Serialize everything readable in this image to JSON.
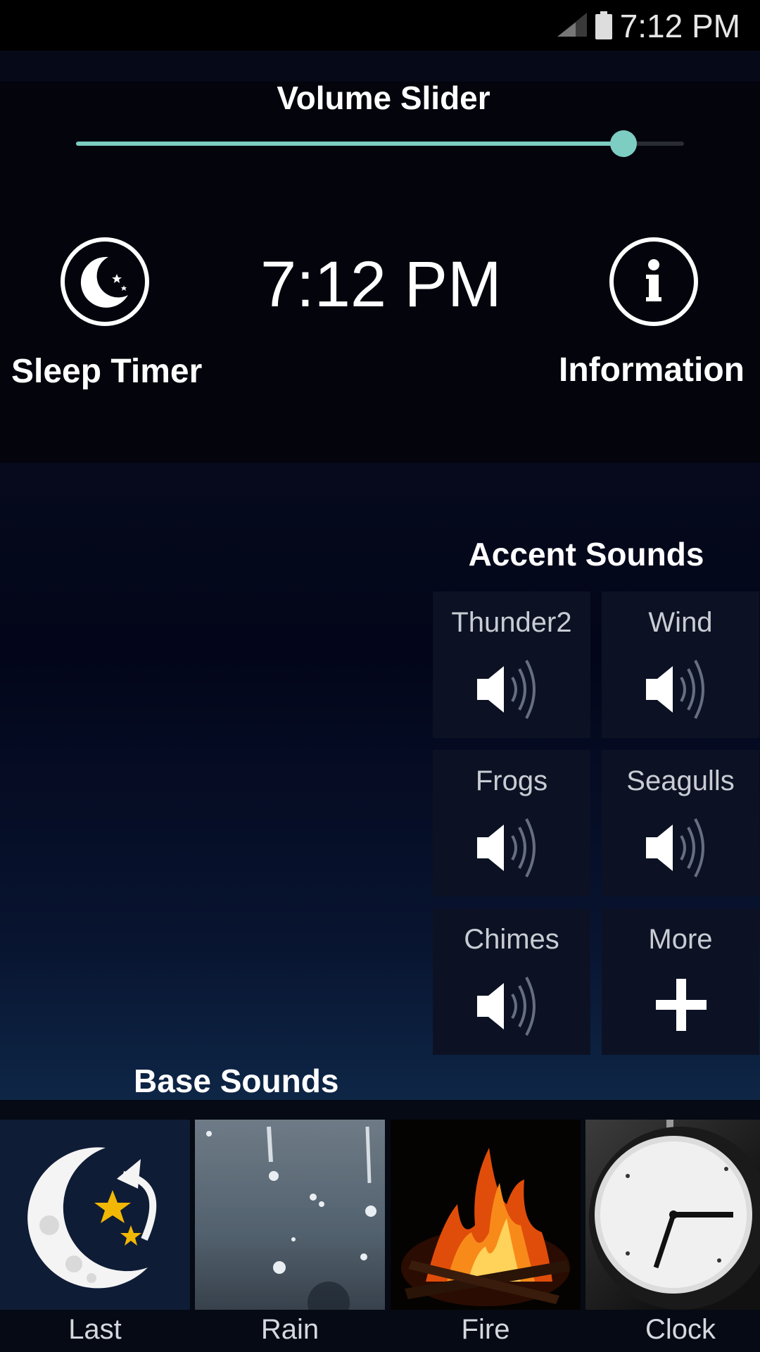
{
  "status_bar": {
    "time": "7:12 PM",
    "signal_icon": "signal-icon",
    "battery_icon": "battery-icon"
  },
  "volume": {
    "title": "Volume Slider",
    "level": 0.9
  },
  "controls": {
    "sleep_timer_label": "Sleep Timer",
    "information_label": "Information",
    "clock": "7:12 PM",
    "sleep_icon": "moon-stars-icon",
    "info_icon": "info-icon"
  },
  "accent": {
    "title": "Accent Sounds",
    "tiles": [
      {
        "label": "Thunder2",
        "icon": "speaker-icon"
      },
      {
        "label": "Wind",
        "icon": "speaker-icon"
      },
      {
        "label": "Frogs",
        "icon": "speaker-icon"
      },
      {
        "label": "Seagulls",
        "icon": "speaker-icon"
      },
      {
        "label": "Chimes",
        "icon": "speaker-icon"
      },
      {
        "label": "More",
        "icon": "plus-icon"
      }
    ]
  },
  "base": {
    "title": "Base Sounds",
    "items": [
      {
        "label": "Last",
        "icon": "moon-replay-icon"
      },
      {
        "label": "Rain",
        "icon": "rain-image"
      },
      {
        "label": "Fire",
        "icon": "fire-image"
      },
      {
        "label": "Clock",
        "icon": "clock-image"
      }
    ]
  },
  "colors": {
    "accent": "#7dcdc2",
    "panel": "#03040c",
    "tile": "#0c1224"
  }
}
